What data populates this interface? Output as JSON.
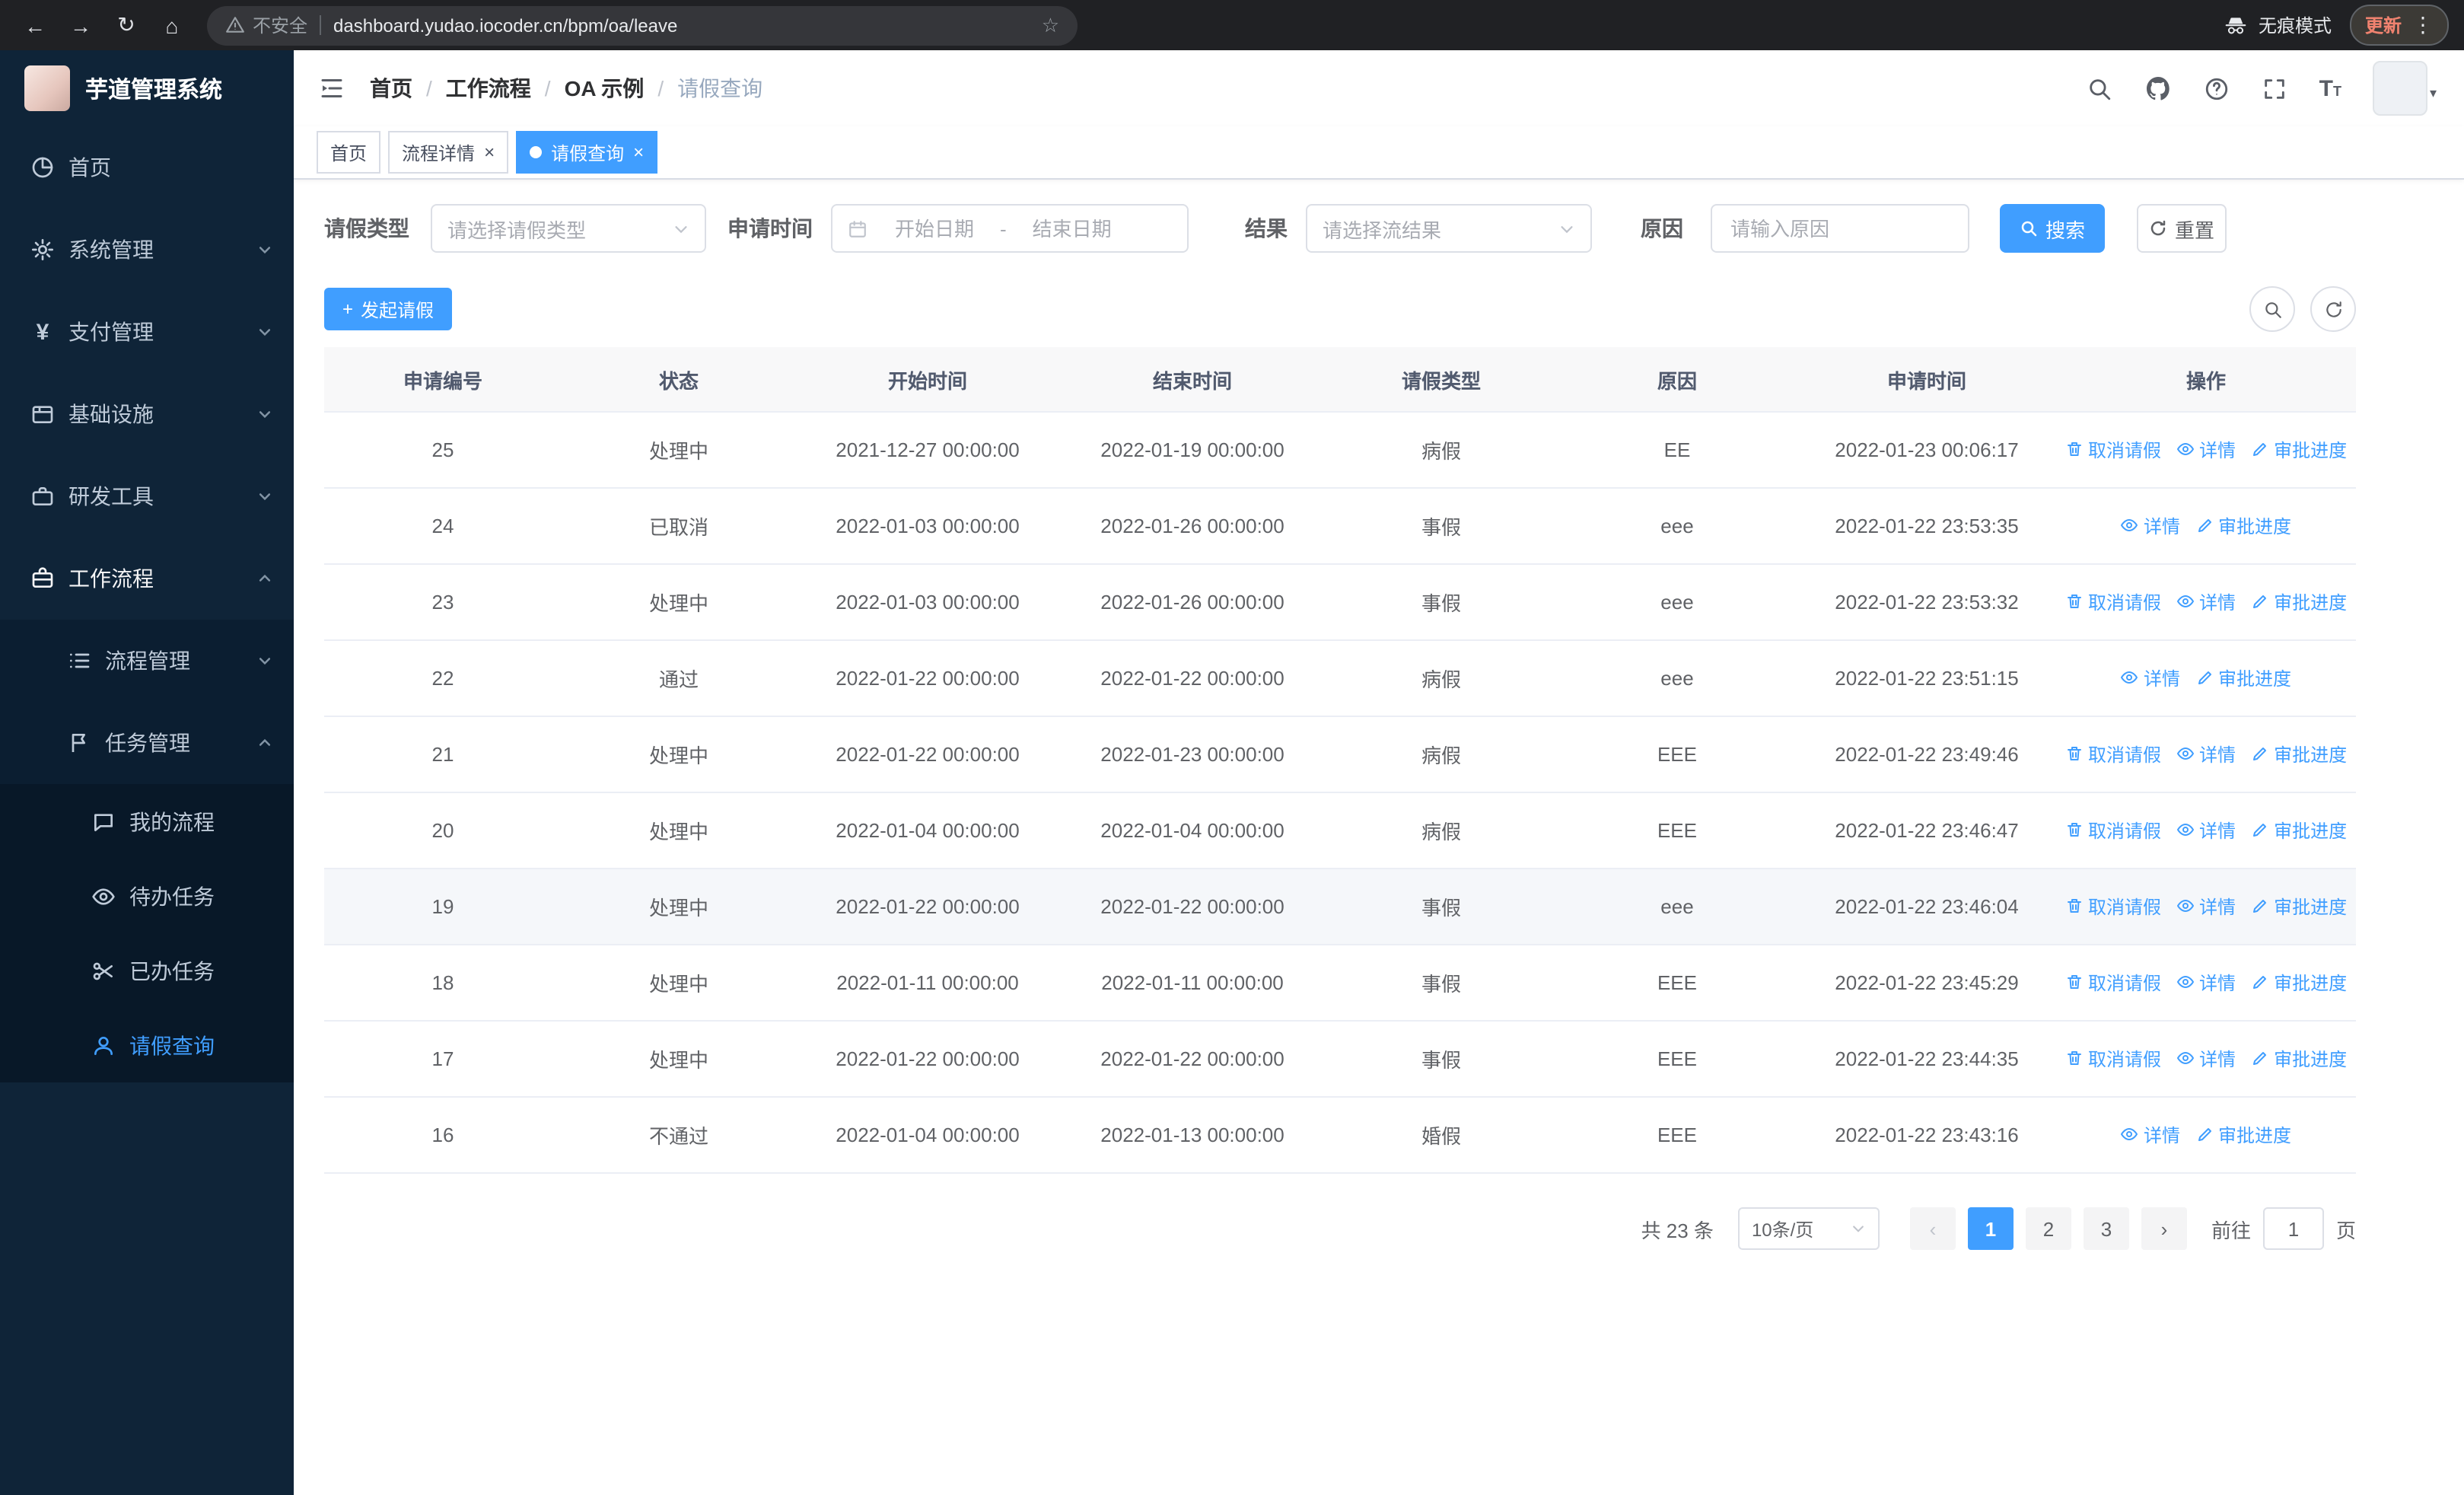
{
  "colors": {
    "primary": "#409eff",
    "sidebar_bg": "#0f2438",
    "link": "#409eff"
  },
  "browser": {
    "icons": {
      "back": "←",
      "forward": "→",
      "reload": "↻",
      "home": "⌂",
      "star": "☆",
      "menu": "⋮"
    },
    "security_label": "不安全",
    "url": "dashboard.yudao.iocoder.cn/bpm/oa/leave",
    "incognito_label": "无痕模式",
    "update_label": "更新"
  },
  "sidebar": {
    "logo_title": "芋道管理系统",
    "yen_glyph": "¥",
    "items": [
      {
        "label": "首页"
      },
      {
        "label": "系统管理"
      },
      {
        "label": "支付管理"
      },
      {
        "label": "基础设施"
      },
      {
        "label": "研发工具"
      },
      {
        "label": "工作流程"
      },
      {
        "label": "流程管理"
      },
      {
        "label": "任务管理"
      },
      {
        "label": "我的流程"
      },
      {
        "label": "待办任务"
      },
      {
        "label": "已办任务"
      },
      {
        "label": "请假查询"
      }
    ]
  },
  "header": {
    "breadcrumb": [
      "首页",
      "工作流程",
      "OA 示例",
      "请假查询"
    ],
    "breadcrumb_separator": "/",
    "font_icon_glyph": "T",
    "avatar_caret": "▾"
  },
  "tabs": {
    "close_glyph": "×",
    "items": [
      {
        "label": "首页"
      },
      {
        "label": "流程详情"
      },
      {
        "label": "请假查询"
      }
    ]
  },
  "filters": {
    "leave_type": {
      "label": "请假类型",
      "placeholder": "请选择请假类型"
    },
    "apply_time": {
      "label": "申请时间",
      "start_placeholder": "开始日期",
      "separator": "-",
      "end_placeholder": "结束日期"
    },
    "result": {
      "label": "结果",
      "placeholder": "请选择流结果"
    },
    "reason": {
      "label": "原因",
      "placeholder": "请输入原因"
    },
    "search_label": "搜索",
    "reset_label": "重置"
  },
  "toolbar": {
    "create_label": "发起请假",
    "create_plus": "+"
  },
  "table": {
    "headers": [
      "申请编号",
      "状态",
      "开始时间",
      "结束时间",
      "请假类型",
      "原因",
      "申请时间",
      "操作"
    ],
    "action_labels": {
      "cancel": "取消请假",
      "detail": "详情",
      "progress": "审批进度"
    },
    "rows": [
      {
        "id": "25",
        "status": "处理中",
        "start": "2021-12-27 00:00:00",
        "end": "2022-01-19 00:00:00",
        "type": "病假",
        "reason": "EE",
        "apply_time": "2022-01-23 00:06:17",
        "actions": [
          "cancel",
          "detail",
          "progress"
        ],
        "highlight": false
      },
      {
        "id": "24",
        "status": "已取消",
        "start": "2022-01-03 00:00:00",
        "end": "2022-01-26 00:00:00",
        "type": "事假",
        "reason": "eee",
        "apply_time": "2022-01-22 23:53:35",
        "actions": [
          "detail",
          "progress"
        ],
        "highlight": false
      },
      {
        "id": "23",
        "status": "处理中",
        "start": "2022-01-03 00:00:00",
        "end": "2022-01-26 00:00:00",
        "type": "事假",
        "reason": "eee",
        "apply_time": "2022-01-22 23:53:32",
        "actions": [
          "cancel",
          "detail",
          "progress"
        ],
        "highlight": false
      },
      {
        "id": "22",
        "status": "通过",
        "start": "2022-01-22 00:00:00",
        "end": "2022-01-22 00:00:00",
        "type": "病假",
        "reason": "eee",
        "apply_time": "2022-01-22 23:51:15",
        "actions": [
          "detail",
          "progress"
        ],
        "highlight": false
      },
      {
        "id": "21",
        "status": "处理中",
        "start": "2022-01-22 00:00:00",
        "end": "2022-01-23 00:00:00",
        "type": "病假",
        "reason": "EEE",
        "apply_time": "2022-01-22 23:49:46",
        "actions": [
          "cancel",
          "detail",
          "progress"
        ],
        "highlight": false
      },
      {
        "id": "20",
        "status": "处理中",
        "start": "2022-01-04 00:00:00",
        "end": "2022-01-04 00:00:00",
        "type": "病假",
        "reason": "EEE",
        "apply_time": "2022-01-22 23:46:47",
        "actions": [
          "cancel",
          "detail",
          "progress"
        ],
        "highlight": false
      },
      {
        "id": "19",
        "status": "处理中",
        "start": "2022-01-22 00:00:00",
        "end": "2022-01-22 00:00:00",
        "type": "事假",
        "reason": "eee",
        "apply_time": "2022-01-22 23:46:04",
        "actions": [
          "cancel",
          "detail",
          "progress"
        ],
        "highlight": true
      },
      {
        "id": "18",
        "status": "处理中",
        "start": "2022-01-11 00:00:00",
        "end": "2022-01-11 00:00:00",
        "type": "事假",
        "reason": "EEE",
        "apply_time": "2022-01-22 23:45:29",
        "actions": [
          "cancel",
          "detail",
          "progress"
        ],
        "highlight": false
      },
      {
        "id": "17",
        "status": "处理中",
        "start": "2022-01-22 00:00:00",
        "end": "2022-01-22 00:00:00",
        "type": "事假",
        "reason": "EEE",
        "apply_time": "2022-01-22 23:44:35",
        "actions": [
          "cancel",
          "detail",
          "progress"
        ],
        "highlight": false
      },
      {
        "id": "16",
        "status": "不通过",
        "start": "2022-01-04 00:00:00",
        "end": "2022-01-13 00:00:00",
        "type": "婚假",
        "reason": "EEE",
        "apply_time": "2022-01-22 23:43:16",
        "actions": [
          "detail",
          "progress"
        ],
        "highlight": false
      }
    ]
  },
  "pagination": {
    "total_label": "共 23 条",
    "page_size_label": "10条/页",
    "prev_glyph": "‹",
    "next_glyph": "›",
    "pages": [
      "1",
      "2",
      "3"
    ],
    "active_index": 0,
    "goto_label": "前往",
    "goto_value": "1",
    "page_unit": "页"
  }
}
